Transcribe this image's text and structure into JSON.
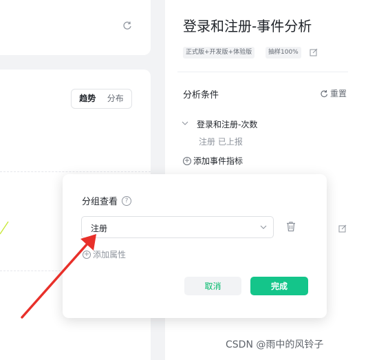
{
  "chart_view": {
    "segments": [
      {
        "label": "趋势",
        "active": true
      },
      {
        "label": "分布",
        "active": false
      }
    ]
  },
  "panel": {
    "title": "登录和注册-事件分析",
    "tags": [
      "正式版+开发版+体验版",
      "抽样100%"
    ],
    "section_title": "分析条件",
    "reset_label": "重置",
    "metric": {
      "name": "登录和注册-次数",
      "sub": "注册 已上报"
    },
    "add_metric_label": "添加事件指标"
  },
  "popover": {
    "title": "分组查看",
    "select_value": "注册",
    "add_attr_label": "添加属性",
    "cancel_label": "取消",
    "confirm_label": "完成"
  },
  "watermark": "CSDN @雨中的风铃子",
  "colors": {
    "primary": "#14c58a",
    "cancel_text": "#00b96b",
    "arrow": "#e8302a",
    "lime_line": "#c9e83a"
  },
  "icons": [
    "refresh-icon",
    "edit-icon",
    "chevron-down-icon",
    "question-icon",
    "trash-icon",
    "plus-circle-icon"
  ]
}
